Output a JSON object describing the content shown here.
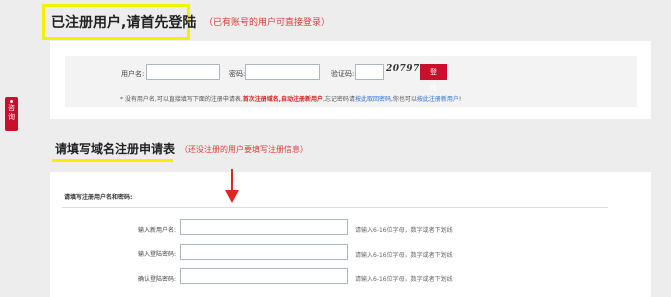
{
  "login": {
    "title": "已注册用户,请首先登陆",
    "hint": "（已有账号的用户可直接登录）",
    "username_label": "用户名:",
    "password_label": "密码:",
    "captcha_label": "验证码:",
    "captcha_text": "20797",
    "submit_label": "登 陆",
    "note_prefix": "* 没有用户名,可以直接填写下面的注册申请表,",
    "note_red": "首次注册域名,自动注册新用户",
    "note_mid": ",忘记密码请",
    "note_link1": "按此取回密码",
    "note_mid2": ",你也可以",
    "note_link2": "按此注册新用户",
    "note_end": "!"
  },
  "side_tab": {
    "label": "咨询"
  },
  "register": {
    "title": "请填写域名注册申请表",
    "hint": "（还没注册的用户要填写注册信息）",
    "section_header": "请填写注册用户名和密码:",
    "fields": [
      {
        "label": "输入新用户名:",
        "hint": "请输入6-16位字母，数字或者下划线"
      },
      {
        "label": "输入登陆密码:",
        "hint": "请输入6-16位字母，数字或者下划线"
      },
      {
        "label": "确认登陆密码:",
        "hint": "请输入6-16位字母，数字或者下划线"
      }
    ]
  }
}
